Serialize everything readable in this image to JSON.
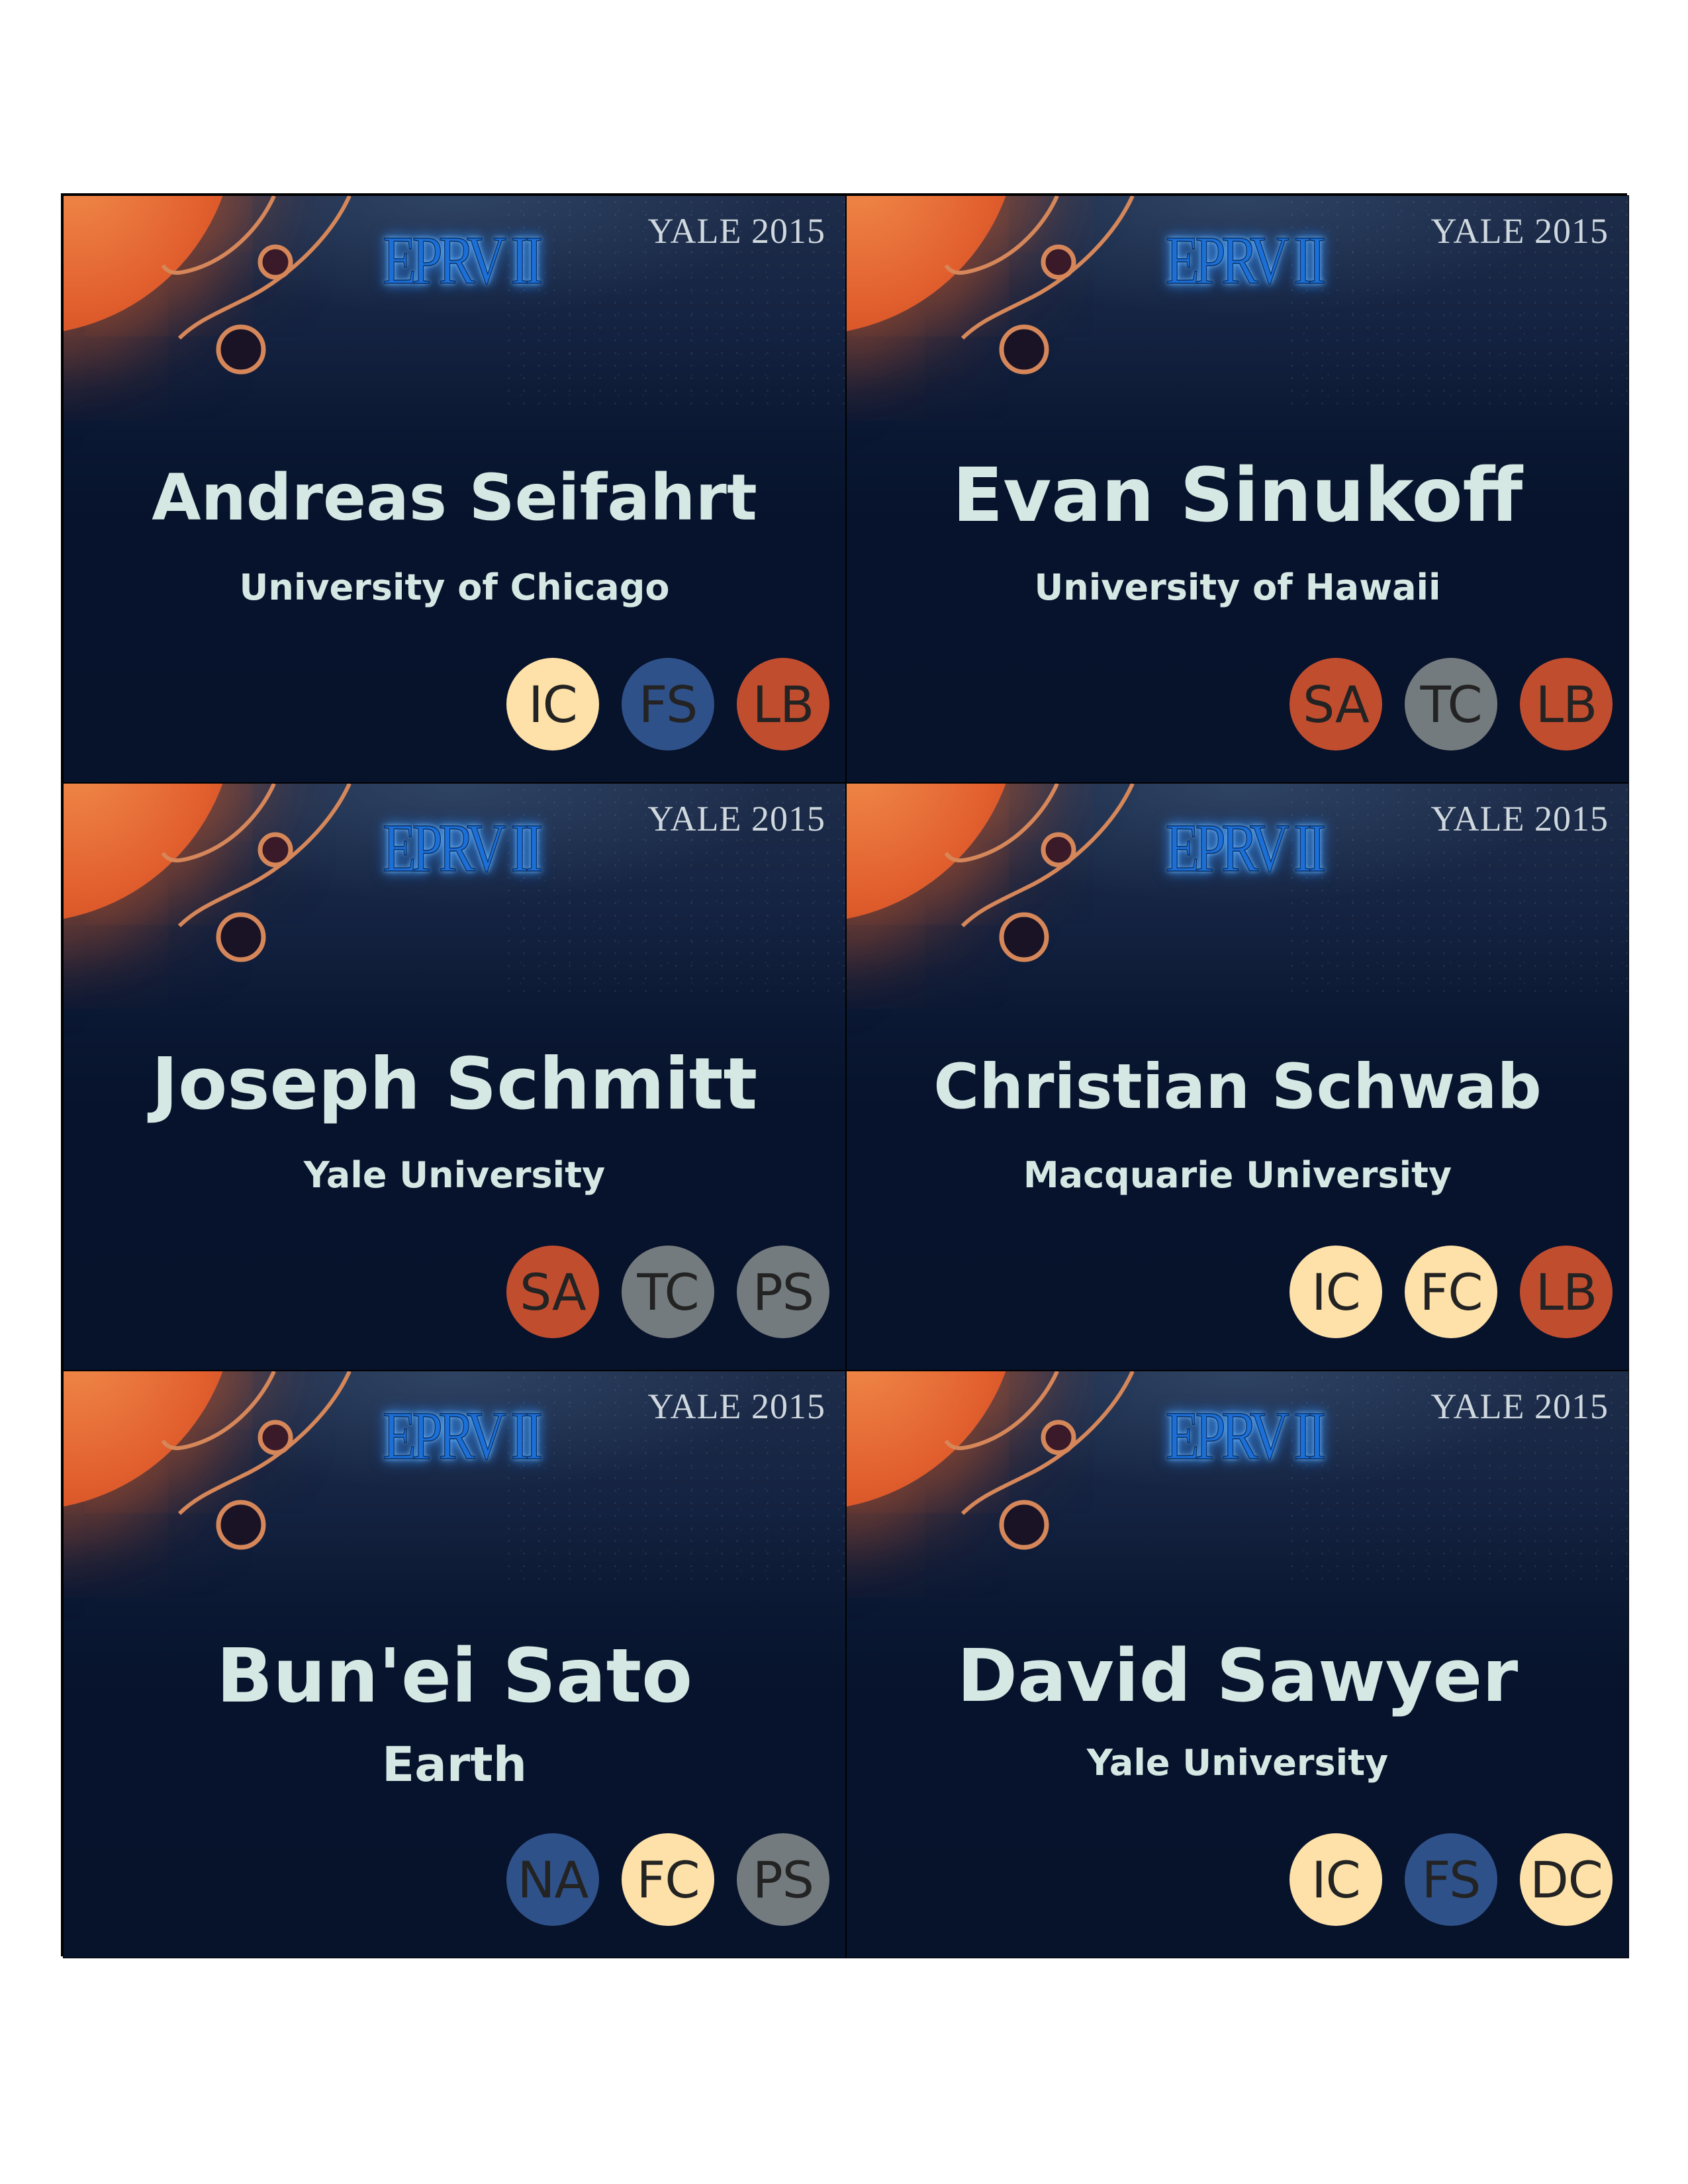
{
  "badges": [
    {
      "logo": "EPRV II",
      "year": "YALE 2015",
      "name": "Andreas Seifahrt",
      "affiliation": "University of Chicago",
      "tags": [
        {
          "label": "IC",
          "color": "cream"
        },
        {
          "label": "FS",
          "color": "blue"
        },
        {
          "label": "LB",
          "color": "red"
        }
      ]
    },
    {
      "logo": "EPRV II",
      "year": "YALE 2015",
      "name": "Evan Sinukoff",
      "affiliation": "University of Hawaii",
      "tags": [
        {
          "label": "SA",
          "color": "red"
        },
        {
          "label": "TC",
          "color": "grey"
        },
        {
          "label": "LB",
          "color": "red"
        }
      ]
    },
    {
      "logo": "EPRV II",
      "year": "YALE 2015",
      "name": "Joseph Schmitt",
      "affiliation": "Yale University",
      "tags": [
        {
          "label": "SA",
          "color": "red"
        },
        {
          "label": "TC",
          "color": "grey"
        },
        {
          "label": "PS",
          "color": "grey"
        }
      ]
    },
    {
      "logo": "EPRV II",
      "year": "YALE 2015",
      "name": "Christian Schwab",
      "affiliation": "Macquarie University",
      "tags": [
        {
          "label": "IC",
          "color": "cream"
        },
        {
          "label": "FC",
          "color": "cream"
        },
        {
          "label": "LB",
          "color": "red"
        }
      ]
    },
    {
      "logo": "EPRV II",
      "year": "YALE 2015",
      "name": "Bun'ei Sato",
      "affiliation": "Earth",
      "tags": [
        {
          "label": "NA",
          "color": "blue"
        },
        {
          "label": "FC",
          "color": "cream"
        },
        {
          "label": "PS",
          "color": "grey"
        }
      ]
    },
    {
      "logo": "EPRV II",
      "year": "YALE 2015",
      "name": "David Sawyer",
      "affiliation": "Yale University",
      "tags": [
        {
          "label": "IC",
          "color": "cream"
        },
        {
          "label": "FS",
          "color": "blue"
        },
        {
          "label": "DC",
          "color": "cream"
        }
      ]
    }
  ],
  "colors": {
    "cream": "#fde1a8",
    "blue": "#2f5189",
    "red": "#c14d2f",
    "grey": "#747b7e",
    "text": "#d6e8e4",
    "background": "#07122b"
  }
}
